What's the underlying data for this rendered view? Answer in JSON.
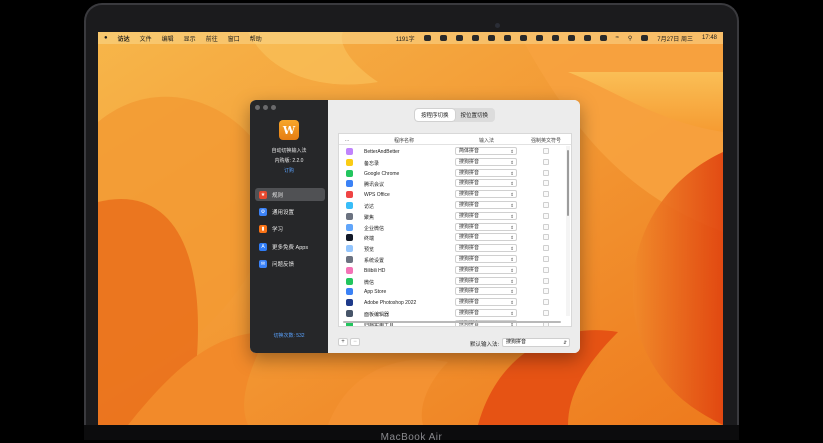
{
  "device": {
    "model_label": "MacBook Air"
  },
  "menubar": {
    "app_name": "访达",
    "menus": [
      "文件",
      "编辑",
      "显示",
      "前往",
      "窗口",
      "帮助"
    ],
    "status": {
      "word_count": "1191字",
      "date": "7月27日 周三",
      "time": "17:48"
    }
  },
  "window": {
    "app_title": "自动切换输入法",
    "version": "内购版: 2.2.0",
    "subscribe": "订购",
    "nav": [
      {
        "label": "规则",
        "icon": "rules-icon",
        "color": "#e8492f"
      },
      {
        "label": "通用设置",
        "icon": "gear-icon",
        "color": "#3b82f6"
      },
      {
        "label": "学习",
        "icon": "book-icon",
        "color": "#f97316"
      },
      {
        "label": "更多免费 Apps",
        "icon": "app-store-icon",
        "color": "#2f7cf6"
      },
      {
        "label": "问题反馈",
        "icon": "feedback-icon",
        "color": "#3b82f6"
      }
    ],
    "switch_count": "切换次数: 532",
    "tabs": [
      "按程序切换",
      "按位置切换"
    ],
    "table": {
      "headers": [
        "...",
        "程序名称",
        "输入法",
        "强制英文符号"
      ],
      "rows": [
        {
          "name": "BetterAndBetter",
          "ime": "简体拼音",
          "color": "#c084fc"
        },
        {
          "name": "备忘录",
          "ime": "搜狗拼音",
          "color": "#facc15"
        },
        {
          "name": "Google Chrome",
          "ime": "搜狗拼音",
          "color": "#22c55e"
        },
        {
          "name": "腾讯会议",
          "ime": "搜狗拼音",
          "color": "#3b82f6"
        },
        {
          "name": "WPS Office",
          "ime": "搜狗拼音",
          "color": "#ef4444"
        },
        {
          "name": "访达",
          "ime": "搜狗拼音",
          "color": "#38bdf8"
        },
        {
          "name": "聚焦",
          "ime": "搜狗拼音",
          "color": "#6b7280"
        },
        {
          "name": "企业微信",
          "ime": "搜狗拼音",
          "color": "#60a5fa"
        },
        {
          "name": "终端",
          "ime": "搜狗拼音",
          "color": "#111827"
        },
        {
          "name": "预览",
          "ime": "搜狗拼音",
          "color": "#93c5fd"
        },
        {
          "name": "系统设置",
          "ime": "搜狗拼音",
          "color": "#6b7280"
        },
        {
          "name": "Bilibili HD",
          "ime": "搜狗拼音",
          "color": "#f472b6"
        },
        {
          "name": "微信",
          "ime": "搜狗拼音",
          "color": "#22c55e"
        },
        {
          "name": "App Store",
          "ime": "搜狗拼音",
          "color": "#3b82f6"
        },
        {
          "name": "Adobe Photoshop 2022",
          "ime": "搜狗拼音",
          "color": "#1e3a8a"
        },
        {
          "name": "面板编辑器",
          "ime": "搜狗拼音",
          "color": "#475569"
        },
        {
          "name": "归档实用工具",
          "ime": "搜狗拼音",
          "color": "#22c55e"
        }
      ]
    },
    "add_button": "+",
    "remove_button": "−",
    "default_ime_label": "默认输入法:",
    "default_ime_value": "搜狗拼音"
  }
}
